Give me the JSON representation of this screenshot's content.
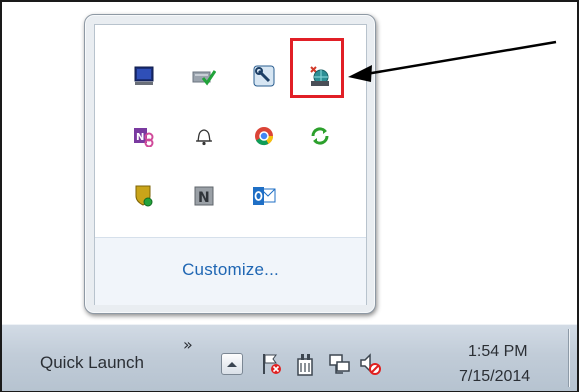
{
  "popup": {
    "customize_label": "Customize...",
    "icons": [
      {
        "name": "display-monitor-icon",
        "row": 0,
        "col": 0
      },
      {
        "name": "card-reader-check-icon",
        "row": 0,
        "col": 1
      },
      {
        "name": "wrench-tool-icon",
        "row": 0,
        "col": 2
      },
      {
        "name": "network-globe-app-icon",
        "row": 0,
        "col": 3,
        "highlighted": true
      },
      {
        "name": "onenote-clip-icon",
        "row": 1,
        "col": 0
      },
      {
        "name": "bell-notification-icon",
        "row": 1,
        "col": 1
      },
      {
        "name": "chrome-icon",
        "row": 1,
        "col": 2
      },
      {
        "name": "sync-arrows-icon",
        "row": 1,
        "col": 3
      },
      {
        "name": "security-shield-icon",
        "row": 2,
        "col": 0
      },
      {
        "name": "n-letter-app-icon",
        "row": 2,
        "col": 1
      },
      {
        "name": "outlook-icon",
        "row": 2,
        "col": 2
      }
    ]
  },
  "annotation": {
    "highlight_color": "#e11f26",
    "arrow_color": "#000000"
  },
  "taskbar": {
    "quick_launch_label": "Quick Launch",
    "chevron": "»",
    "tray_icons": [
      "action-center-flag-icon",
      "power-plug-icon",
      "network-icon",
      "volume-muted-icon"
    ],
    "clock_time": "1:54 PM",
    "clock_date": "7/15/2014"
  }
}
